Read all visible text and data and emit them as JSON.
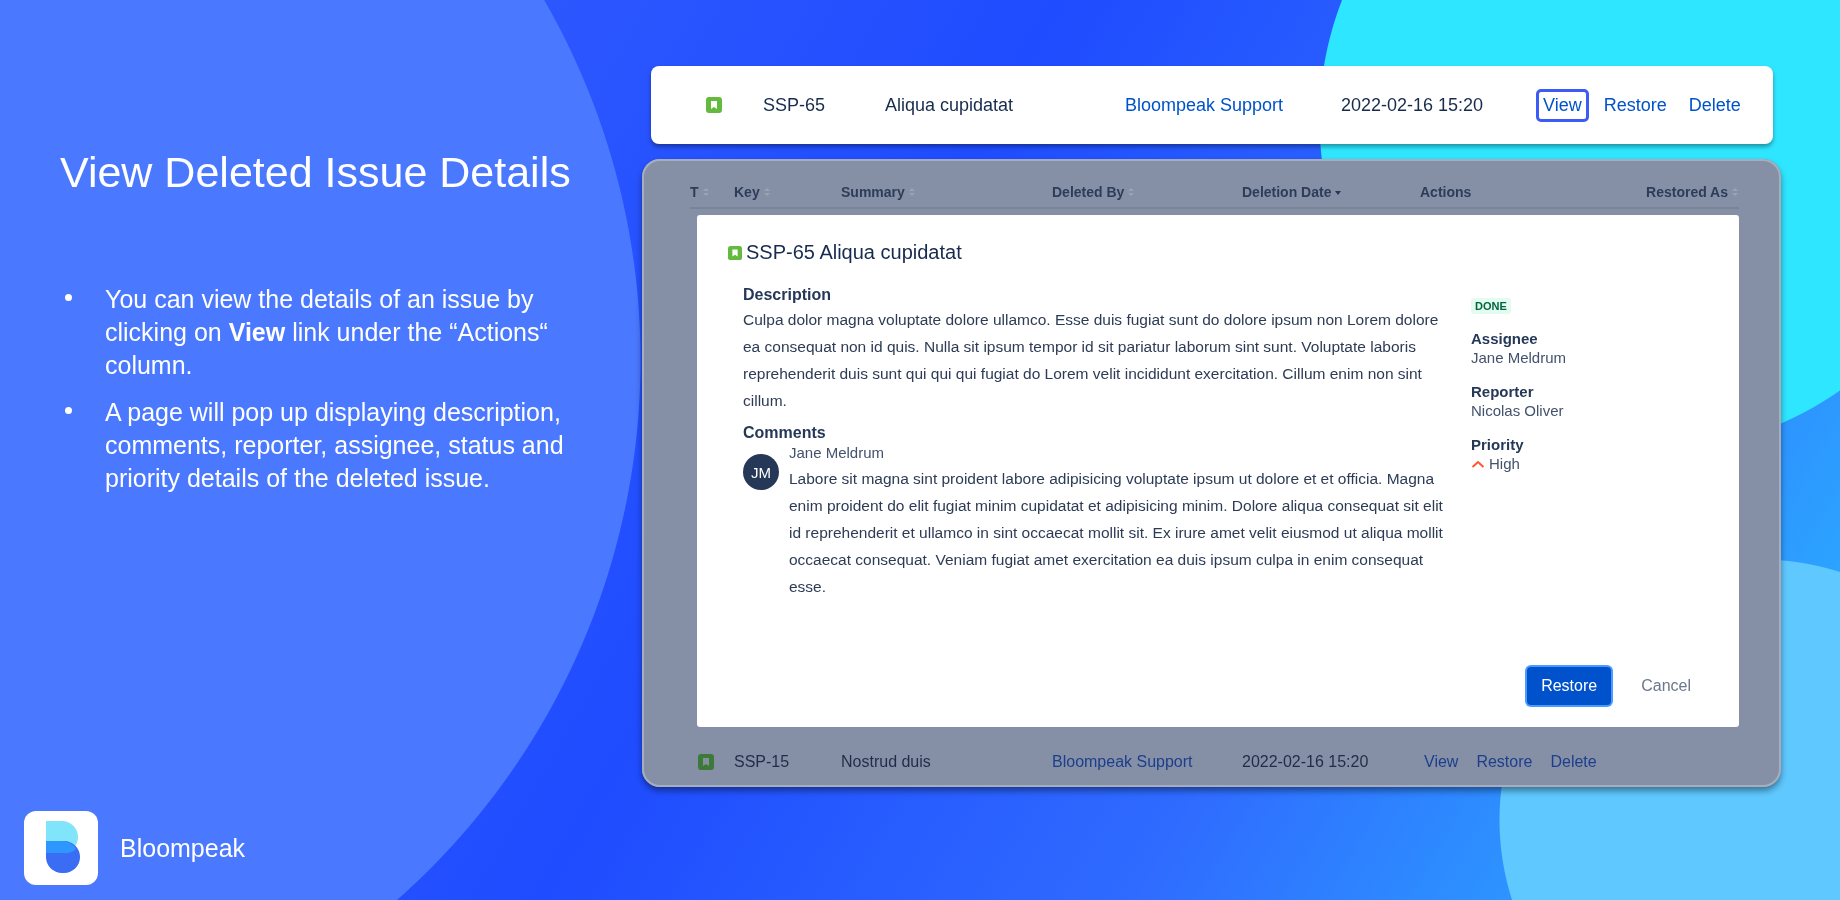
{
  "slide": {
    "title": "View Deleted Issue Details",
    "bullets": [
      "You can view the details of an issue by clicking on **View** link under the “Actions“ column.",
      "A page will pop up displaying description, comments, reporter, assignee, status and priority details of the deleted issue."
    ]
  },
  "highlighted_row": {
    "key": "SSP-65",
    "summary": "Aliqua cupidatat",
    "deleted_by": "Bloompeak Support",
    "date": "2022-02-16 15:20",
    "actions": [
      {
        "label": "View",
        "highlighted": true
      },
      {
        "label": "Restore",
        "highlighted": false
      },
      {
        "label": "Delete",
        "highlighted": false
      }
    ]
  },
  "table": {
    "columns": [
      {
        "label": "T",
        "sorted": false
      },
      {
        "label": "Key",
        "sorted": false
      },
      {
        "label": "Summary",
        "sorted": false
      },
      {
        "label": "Deleted By",
        "sorted": false
      },
      {
        "label": "Deletion Date",
        "sorted": true
      },
      {
        "label": "Actions"
      },
      {
        "label": "Restored As",
        "sorted": false
      }
    ],
    "rows": [
      {
        "key": "SSP-15",
        "summary": "Nostrud duis",
        "deleted_by": "Bloompeak Support",
        "date": "2022-02-16 15:20",
        "actions": [
          {
            "label": "View",
            "highlighted": false
          },
          {
            "label": "Restore",
            "highlighted": false
          },
          {
            "label": "Delete",
            "highlighted": false
          }
        ]
      }
    ]
  },
  "modal": {
    "title": "SSP-65 Aliqua cupidatat",
    "description_heading": "Description",
    "description": "Culpa dolor magna voluptate dolore ullamco. Esse duis fugiat sunt do dolore ipsum non Lorem dolore ea consequat non id quis. Nulla sit ipsum tempor id sit pariatur laborum sint sunt. Voluptate laboris reprehenderit duis sunt qui qui qui fugiat do Lorem velit incididunt exercitation. Cillum enim non sint cillum.",
    "comments_heading": "Comments",
    "comments": [
      {
        "initials": "JM",
        "author": "Jane Meldrum",
        "text": "Labore sit magna sint proident labore adipisicing voluptate ipsum ut dolore et et officia. Magna enim proident do elit fugiat minim cupidatat et adipisicing minim. Dolore aliqua consequat sit elit id reprehenderit et ullamco in sint occaecat mollit sit. Ex irure amet velit eiusmod ut aliqua mollit occaecat consequat. Veniam fugiat amet exercitation ea duis ipsum culpa in enim consequat esse."
      }
    ],
    "status": "DONE",
    "fields": [
      {
        "label": "Assignee",
        "value": "Jane Meldrum",
        "kind": "text"
      },
      {
        "label": "Reporter",
        "value": "Nicolas Oliver",
        "kind": "text"
      },
      {
        "label": "Priority",
        "value": "High",
        "kind": "priority"
      }
    ],
    "buttons": [
      {
        "label": "Restore",
        "kind": "primary"
      },
      {
        "label": "Cancel",
        "kind": "subtle"
      }
    ]
  },
  "brand": {
    "name": "Bloompeak"
  }
}
